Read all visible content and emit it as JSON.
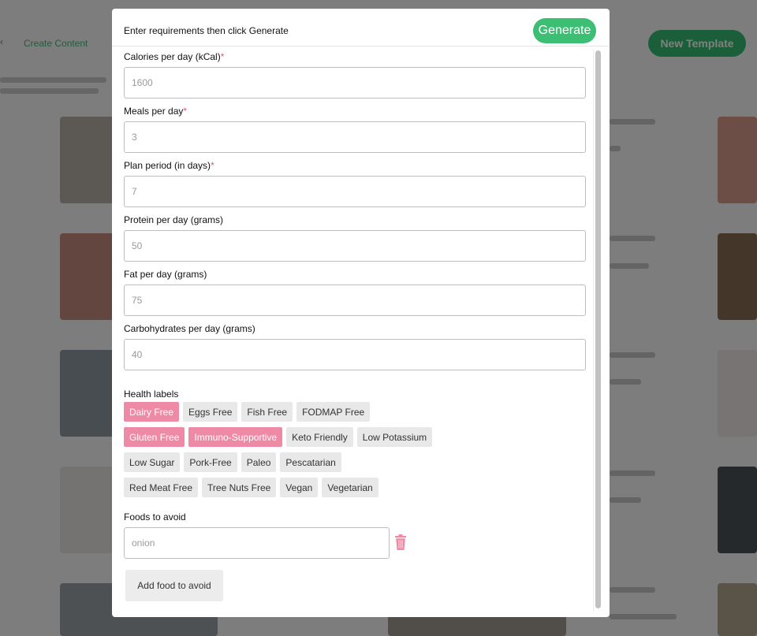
{
  "background": {
    "tab_label": "Create Content",
    "new_button_label": "New Template"
  },
  "modal": {
    "title": "Enter requirements then click Generate",
    "generate_label": "Generate",
    "fields": [
      {
        "label": "Calories per day (kCal)",
        "required": "*",
        "placeholder": "1600"
      },
      {
        "label": "Meals per day",
        "required": "*",
        "placeholder": "3"
      },
      {
        "label": "Plan period (in days)",
        "required": "*",
        "placeholder": "7"
      },
      {
        "label": "Protein per day (grams)",
        "required": "",
        "placeholder": "50"
      },
      {
        "label": "Fat per day (grams)",
        "required": "",
        "placeholder": "75"
      },
      {
        "label": "Carbohydrates per day (grams)",
        "required": "",
        "placeholder": "40"
      }
    ],
    "health_labels_title": "Health labels",
    "health_labels": [
      {
        "label": "Dairy Free",
        "selected": true
      },
      {
        "label": "Eggs Free",
        "selected": false
      },
      {
        "label": "Fish Free",
        "selected": false
      },
      {
        "label": "FODMAP Free",
        "selected": false
      },
      {
        "label": "Gluten Free",
        "selected": true
      },
      {
        "label": "Immuno-Supportive",
        "selected": true
      },
      {
        "label": "Keto Friendly",
        "selected": false
      },
      {
        "label": "Low Potassium",
        "selected": false
      },
      {
        "label": "Low Sugar",
        "selected": false
      },
      {
        "label": "Pork-Free",
        "selected": false
      },
      {
        "label": "Paleo",
        "selected": false
      },
      {
        "label": "Pescatarian",
        "selected": false
      },
      {
        "label": "Red Meat Free",
        "selected": false
      },
      {
        "label": "Tree Nuts Free",
        "selected": false
      },
      {
        "label": "Vegan",
        "selected": false
      },
      {
        "label": "Vegetarian",
        "selected": false
      }
    ],
    "foods_to_avoid_title": "Foods to avoid",
    "food_input_placeholder": "onion",
    "trash_icon": "trash-icon",
    "add_food_label": "Add food to avoid"
  },
  "colors": {
    "accent_green": "#3cbf74",
    "chip_selected": "#ef8aa6",
    "required_star": "#e05a6d"
  }
}
